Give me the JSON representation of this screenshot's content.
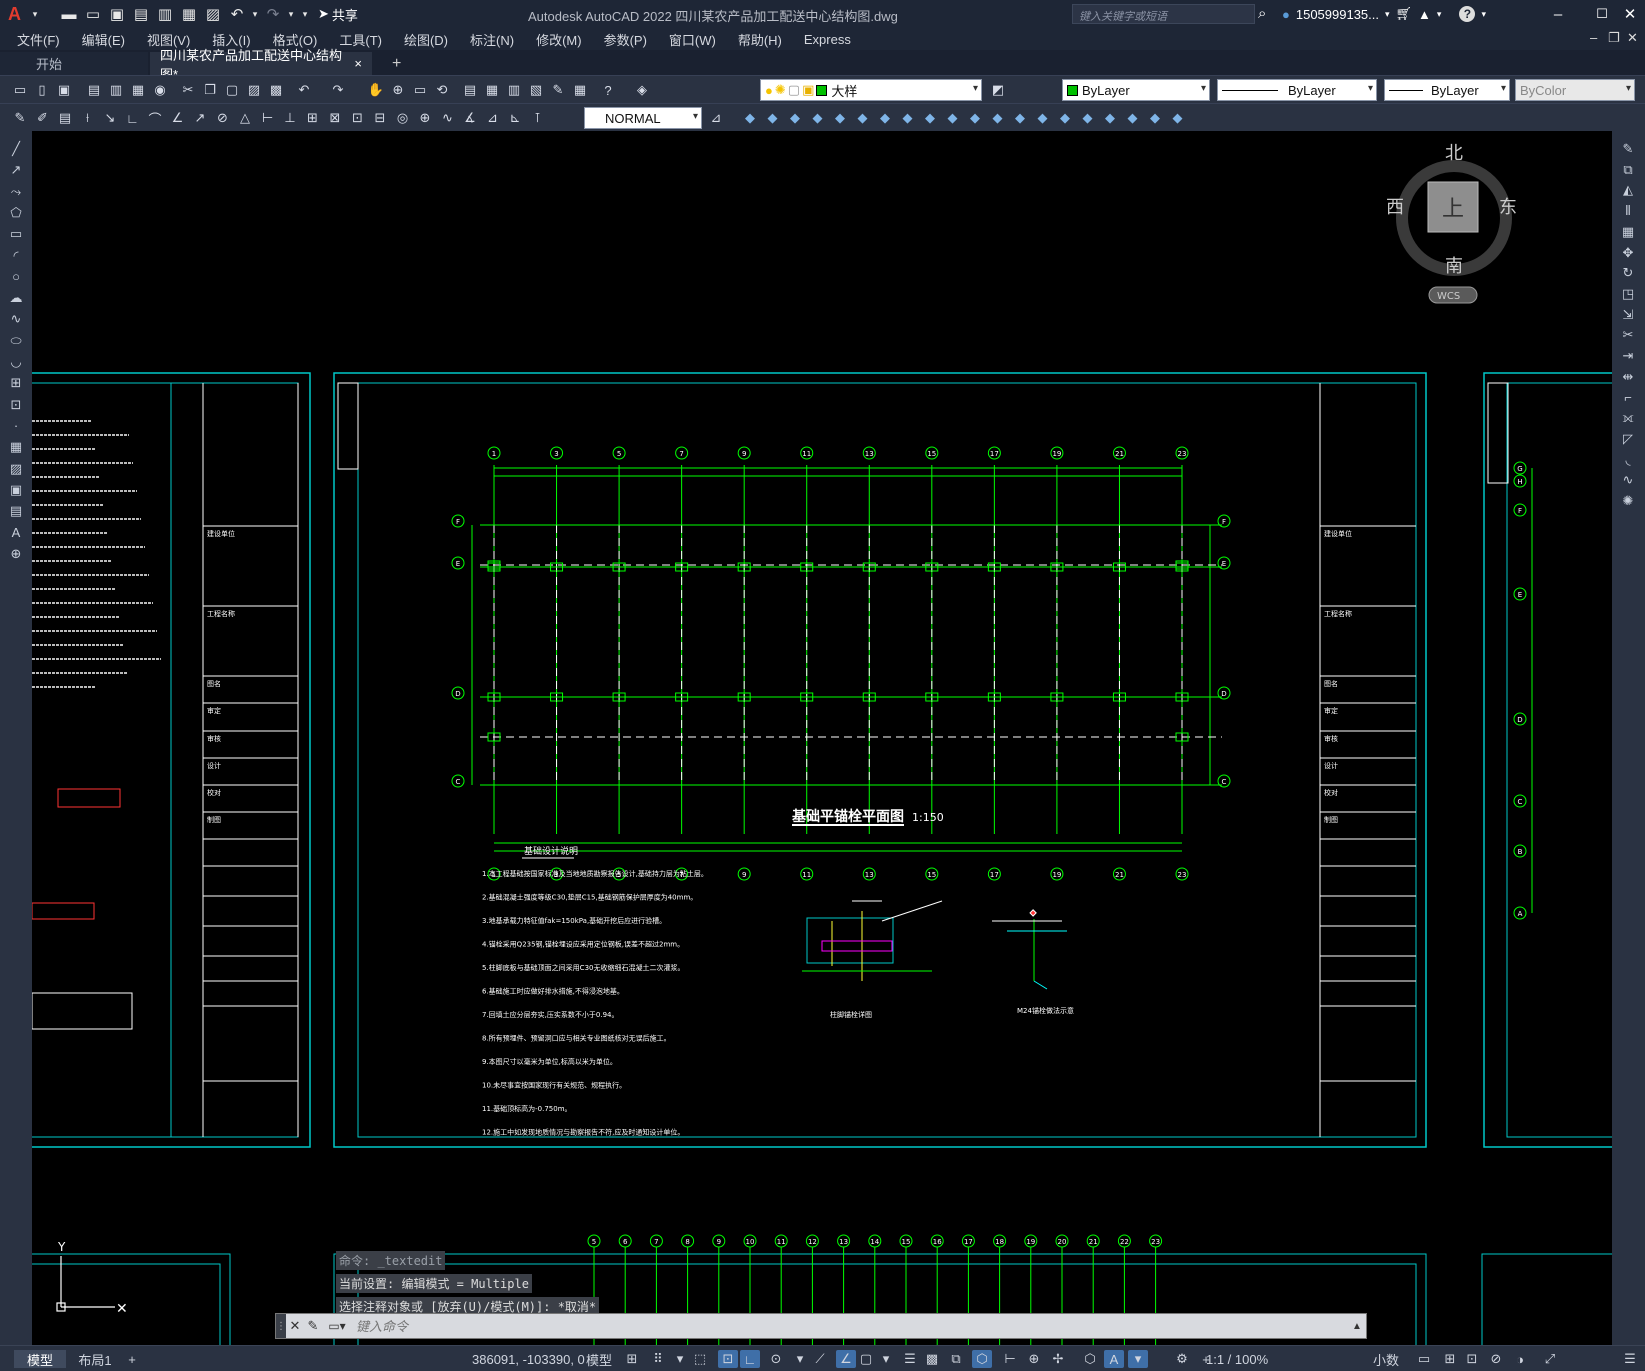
{
  "app": {
    "title": "Autodesk AutoCAD 2022    四川某农产品加工配送中心结构图.dwg",
    "logo": "A",
    "share_label": "共享",
    "search_placeholder": "键入关键字或短语",
    "user": "1505999135...",
    "colors": {
      "titlebar": "#1e2636",
      "accent": "#3f6fa8",
      "drawing_bg": "#000000",
      "frame": "#00c8c8",
      "grid_green": "#00ff00"
    }
  },
  "menu": [
    "文件(F)",
    "编辑(E)",
    "视图(V)",
    "插入(I)",
    "格式(O)",
    "工具(T)",
    "绘图(D)",
    "标注(N)",
    "修改(M)",
    "参数(P)",
    "窗口(W)",
    "帮助(H)",
    "Express"
  ],
  "tabs": {
    "start": "开始",
    "drawing": "四川某农产品加工配送中心结构图*",
    "close": "×",
    "add": "+"
  },
  "toolbar1": {
    "layer_value": "大样",
    "color_value": "ByLayer",
    "linetype_value": "ByLayer",
    "lineweight_value": "ByLayer",
    "plotstyle_value": "ByColor"
  },
  "toolbar2": {
    "dimstyle_value": "NORMAL"
  },
  "viewcube": {
    "north": "北",
    "south": "南",
    "east": "东",
    "west": "西",
    "top": "上",
    "wcs": "WCS"
  },
  "drawing": {
    "plan_title": "基础平锚栓平面图",
    "plan_scale": "1:150",
    "notes_title": "基础设计说明",
    "detail_caption_1": "柱脚锚栓详图",
    "detail_caption_2": "M24锚栓做法示意",
    "top_axes": [
      "1",
      "3",
      "5",
      "7",
      "9",
      "11",
      "13",
      "15",
      "17",
      "19",
      "21",
      "23"
    ],
    "row_axes": [
      "F",
      "E",
      "D",
      "C"
    ],
    "notes": [
      "1.本工程基础按国家标准及当地地质勘察报告设计,基础持力层为粘土层。",
      "2.基础混凝土强度等级C30,垫层C15,基础钢筋保护层厚度为40mm。",
      "3.地基承载力特征值fak=150kPa,基础开挖后应进行验槽。",
      "4.锚栓采用Q235钢,锚栓埋设应采用定位钢板,误差不超过2mm。",
      "5.柱脚底板与基础顶面之间采用C30无收缩细石混凝土二次灌浆。",
      "6.基础施工时应做好排水措施,不得浸泡地基。",
      "7.回填土应分层夯实,压实系数不小于0.94。",
      "8.所有预埋件、预留洞口应与相关专业图纸核对无误后施工。",
      "9.本图尺寸以毫米为单位,标高以米为单位。",
      "10.未尽事宜按国家现行有关规范、规程执行。",
      "11.基础顶标高为-0.750m。",
      "12.施工中如发现地质情况与勘察报告不符,应及时通知设计单位。"
    ],
    "left_sheet_frames": true,
    "left_titleblock": [
      "建设单位",
      "工程名称",
      "图名",
      "审定",
      "审核",
      "设计",
      "校对",
      "制图"
    ]
  },
  "command": {
    "history": [
      "命令: _textedit",
      "当前设置: 编辑模式 = Multiple",
      "选择注释对象或 [放弃(U)/模式(M)]: *取消*"
    ],
    "placeholder": "键入命令",
    "bottom_axes": [
      "5",
      "6",
      "7",
      "8",
      "9",
      "10",
      "11",
      "12",
      "13",
      "14",
      "15",
      "16",
      "17",
      "18",
      "19",
      "20",
      "21",
      "22",
      "23"
    ]
  },
  "status": {
    "layout_tabs": [
      "模型",
      "布局1"
    ],
    "add": "+",
    "coords": "386091, -103390, 0",
    "model": "模型",
    "scale": "1:1 / 100%",
    "units": "小数"
  }
}
